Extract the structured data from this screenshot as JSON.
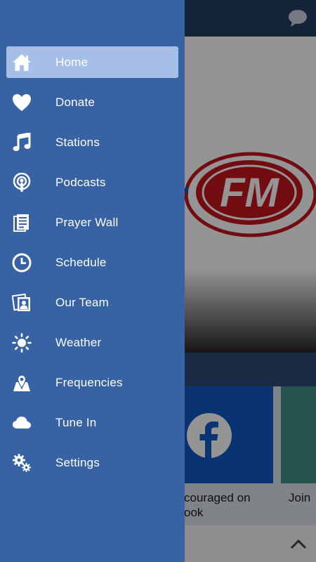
{
  "app": {
    "logo_text": "FM",
    "cards": [
      {
        "caption": "couraged on\nook",
        "color": "#1258c4"
      },
      {
        "caption": "Join",
        "color": "#3f8f86"
      }
    ]
  },
  "drawer": {
    "background": "#3762a4",
    "active_highlight": "#a6bfe6",
    "items": [
      {
        "label": "Home",
        "icon": "home-icon",
        "active": true
      },
      {
        "label": "Donate",
        "icon": "heart-icon"
      },
      {
        "label": "Stations",
        "icon": "music-note-icon"
      },
      {
        "label": "Podcasts",
        "icon": "podcast-icon"
      },
      {
        "label": "Prayer Wall",
        "icon": "document-icon"
      },
      {
        "label": "Schedule",
        "icon": "clock-icon"
      },
      {
        "label": "Our Team",
        "icon": "team-photo-icon"
      },
      {
        "label": "Weather",
        "icon": "sun-icon"
      },
      {
        "label": "Frequencies",
        "icon": "map-pin-icon"
      },
      {
        "label": "Tune In",
        "icon": "cloud-icon"
      },
      {
        "label": "Settings",
        "icon": "gears-icon"
      }
    ]
  },
  "colors": {
    "brand_red": "#c4161c",
    "facebook_blue": "#1258c4"
  }
}
